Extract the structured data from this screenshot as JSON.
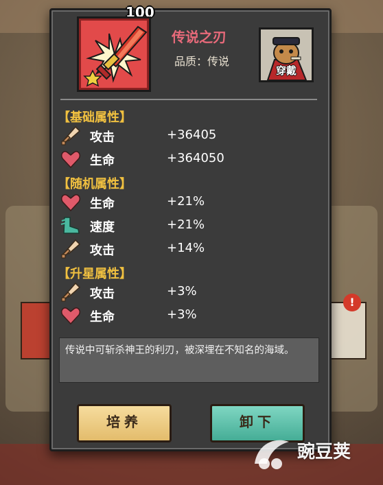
{
  "item": {
    "level": "100",
    "name": "传说之刃",
    "quality_text": "品质：传说",
    "name_color": "#e86a7a",
    "frame_color": "#e24a4a"
  },
  "wearer": {
    "label": "穿戴"
  },
  "sections": {
    "base": {
      "title": "【基础属性】",
      "rows": [
        {
          "icon": "sword-icon",
          "label": "攻击",
          "value": "+36405"
        },
        {
          "icon": "heart-icon",
          "label": "生命",
          "value": "+364050"
        }
      ]
    },
    "random": {
      "title": "【随机属性】",
      "rows": [
        {
          "icon": "heart-icon",
          "label": "生命",
          "value": "+21%"
        },
        {
          "icon": "boot-icon",
          "label": "速度",
          "value": "+21%"
        },
        {
          "icon": "sword-icon",
          "label": "攻击",
          "value": "+14%"
        }
      ]
    },
    "star": {
      "title": "【升星属性】",
      "rows": [
        {
          "icon": "sword-icon",
          "label": "攻击",
          "value": "+3%"
        },
        {
          "icon": "heart-icon",
          "label": "生命",
          "value": "+3%"
        }
      ]
    }
  },
  "description": "传说中可斩杀神王的利刃，被深埋在不知名的海域。",
  "buttons": {
    "train": "培养",
    "remove": "卸下"
  },
  "watermark": {
    "text": "豌豆荚"
  },
  "colors": {
    "section_title": "#f0c040",
    "panel": "#3b3b3b",
    "train_button": "#f0d090",
    "remove_button": "#5cc4ad"
  }
}
